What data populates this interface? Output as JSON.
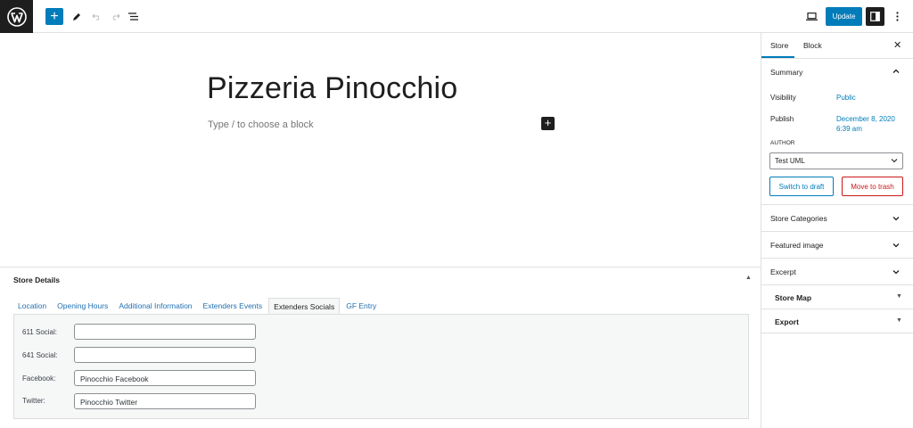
{
  "topbar": {
    "logo": "wordpress-logo",
    "add_block_icon": "plus-icon",
    "tools_icon": "pencil-icon",
    "undo_icon": "undo-icon",
    "redo_icon": "redo-icon",
    "outline_icon": "list-view-icon",
    "preview_icon": "desktop-icon",
    "update_label": "Update",
    "settings_icon": "sidebar-icon",
    "options_icon": "more-vertical-icon"
  },
  "editor": {
    "title": "Pizzeria Pinocchio",
    "placeholder": "Type / to choose a block"
  },
  "metabox": {
    "title": "Store Details",
    "tabs": [
      {
        "label": "Location",
        "active": false
      },
      {
        "label": "Opening Hours",
        "active": false
      },
      {
        "label": "Additional Information",
        "active": false
      },
      {
        "label": "Extenders Events",
        "active": false
      },
      {
        "label": "Extenders Socials",
        "active": true
      },
      {
        "label": "GF Entry",
        "active": false
      }
    ],
    "fields": [
      {
        "label": "611 Social:",
        "value": ""
      },
      {
        "label": "641 Social:",
        "value": ""
      },
      {
        "label": "Facebook:",
        "value": "Pinocchio Facebook"
      },
      {
        "label": "Twitter:",
        "value": "Pinocchio Twitter"
      }
    ]
  },
  "sidebar": {
    "tabs": [
      "Store",
      "Block"
    ],
    "active_tab": "Store",
    "summary": {
      "title": "Summary",
      "visibility_label": "Visibility",
      "visibility_value": "Public",
      "publish_label": "Publish",
      "publish_date": "December 8, 2020",
      "publish_time": "6:39 am",
      "author_label": "AUTHOR",
      "author_value": "Test UML",
      "switch_draft_label": "Switch to draft",
      "trash_label": "Move to trash"
    },
    "panels": [
      "Store Categories",
      "Featured image",
      "Excerpt"
    ],
    "metaboxes": [
      "Store Map",
      "Export"
    ]
  },
  "colors": {
    "accent": "#007cba",
    "danger": "#cc1818",
    "dark": "#1e1e1e",
    "border": "#e0e0e0"
  }
}
